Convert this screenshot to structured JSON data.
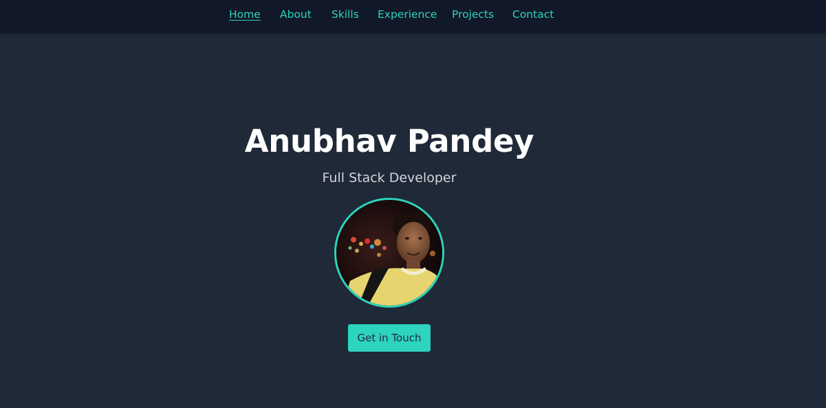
{
  "nav": {
    "items": [
      {
        "label": "Home",
        "active": true
      },
      {
        "label": "About"
      },
      {
        "label": "Skills"
      },
      {
        "label": "Experience"
      },
      {
        "label": "Projects"
      },
      {
        "label": "Contact"
      }
    ]
  },
  "hero": {
    "name": "Anubhav Pandey",
    "role": "Full Stack Developer",
    "cta_label": "Get in Touch"
  },
  "colors": {
    "page_background": "#1f2937",
    "nav_background": "#111827",
    "accent": "#2dd4bf",
    "heading_text": "#ffffff",
    "subheading_text": "#d1d5db"
  }
}
